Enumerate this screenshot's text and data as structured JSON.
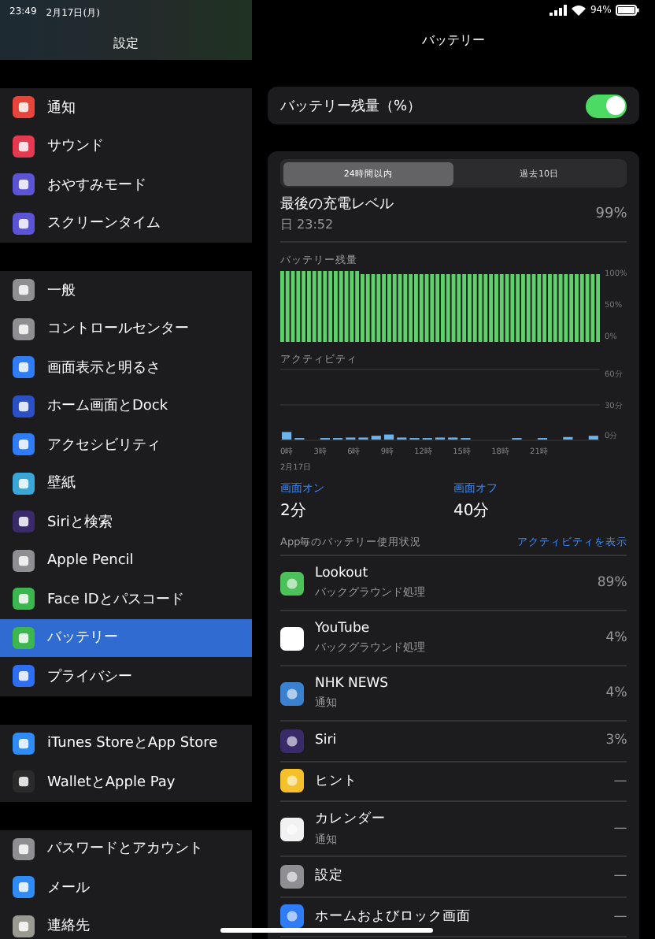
{
  "status_bar": {
    "time": "23:49",
    "date": "2月17日(月)",
    "battery": "94%"
  },
  "sidebar": {
    "title": "設定",
    "groups": [
      [
        {
          "label": "通知",
          "color": "#e5453a",
          "selected": false
        },
        {
          "label": "サウンド",
          "color": "#e53950",
          "selected": false
        },
        {
          "label": "おやすみモード",
          "color": "#5b55d6",
          "selected": false
        },
        {
          "label": "スクリーンタイム",
          "color": "#5b55d6",
          "selected": false
        }
      ],
      [
        {
          "label": "一般",
          "color": "#8e8e93",
          "selected": false
        },
        {
          "label": "コントロールセンター",
          "color": "#8e8e93",
          "selected": false
        },
        {
          "label": "画面表示と明るさ",
          "color": "#2f7cf6",
          "selected": false
        },
        {
          "label": "ホーム画面とDock",
          "color": "#2b4fc4",
          "selected": false
        },
        {
          "label": "アクセシビリティ",
          "color": "#2f7cf6",
          "selected": false
        },
        {
          "label": "壁紙",
          "color": "#3aa6d8",
          "selected": false
        },
        {
          "label": "Siriと検索",
          "color": "#3a2a6a",
          "selected": false
        },
        {
          "label": "Apple Pencil",
          "color": "#8e8e93",
          "selected": false
        },
        {
          "label": "Face IDとパスコード",
          "color": "#3cb64f",
          "selected": false
        },
        {
          "label": "バッテリー",
          "color": "#3cb64f",
          "selected": true
        },
        {
          "label": "プライバシー",
          "color": "#2f6ef0",
          "selected": false
        }
      ],
      [
        {
          "label": "iTunes StoreとApp Store",
          "color": "#2f8cf6",
          "selected": false
        },
        {
          "label": "WalletとApple Pay",
          "color": "#2a2a2a",
          "selected": false
        }
      ],
      [
        {
          "label": "パスワードとアカウント",
          "color": "#8e8e93",
          "selected": false
        },
        {
          "label": "メール",
          "color": "#2f8cf6",
          "selected": false
        },
        {
          "label": "連絡先",
          "color": "#9a9a90",
          "selected": false
        }
      ]
    ]
  },
  "detail": {
    "title": "バッテリー",
    "percentage_toggle": {
      "label": "バッテリー残量（%）",
      "on": true
    },
    "tabs": [
      {
        "label": "24時間以内",
        "selected": true
      },
      {
        "label": "過去10日",
        "selected": false
      }
    ],
    "last_charge": {
      "label": "最後の充電レベル",
      "time": "日 23:52",
      "value": "99%"
    },
    "battery_chart": {
      "title": "バッテリー残量",
      "y_labels": [
        "100%",
        "50%",
        "0%"
      ]
    },
    "activity_chart": {
      "title": "アクティビティ",
      "y_labels": [
        "60分",
        "30分",
        "0分"
      ],
      "x_labels": [
        "0時",
        "3時",
        "6時",
        "9時",
        "12時",
        "15時",
        "18時",
        "21時"
      ],
      "date": "2月17日"
    },
    "screen_on": {
      "label": "画面オン",
      "value": "2分"
    },
    "screen_off": {
      "label": "画面オフ",
      "value": "40分"
    },
    "usage": {
      "title": "App毎のバッテリー使用状況",
      "link": "アクティビティを表示",
      "apps": [
        {
          "name": "Lookout",
          "detail": "バックグラウンド処理",
          "value": "89%",
          "color": "#4cc15a"
        },
        {
          "name": "YouTube",
          "detail": "バックグラウンド処理",
          "value": "4%",
          "color": "#ffffff"
        },
        {
          "name": "NHK NEWS",
          "detail": "通知",
          "value": "4%",
          "color": "#3a82d0"
        },
        {
          "name": "Siri",
          "value": "3%",
          "color": "#3a2a6a"
        },
        {
          "name": "ヒント",
          "value": "—",
          "color": "#f5c02a"
        },
        {
          "name": "カレンダー",
          "detail": "通知",
          "value": "—",
          "color": "#f2f2f2"
        },
        {
          "name": "設定",
          "value": "—",
          "color": "#8e8e93"
        },
        {
          "name": "ホームおよびロック画面",
          "value": "—",
          "color": "#2f7cf6"
        }
      ]
    }
  }
}
